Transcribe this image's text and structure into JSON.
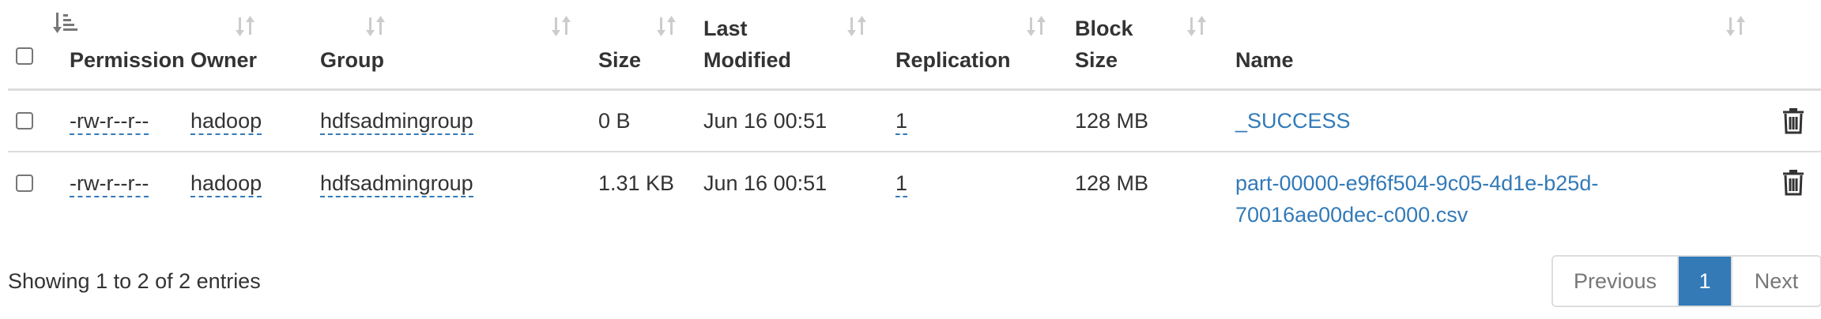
{
  "table": {
    "columns": [
      {
        "key": "select",
        "label": ""
      },
      {
        "key": "permission",
        "label": "Permission"
      },
      {
        "key": "owner",
        "label": "Owner"
      },
      {
        "key": "group",
        "label": "Group"
      },
      {
        "key": "size",
        "label": "Size"
      },
      {
        "key": "last_modified",
        "label_line1": "Last",
        "label_line2": "Modified"
      },
      {
        "key": "replication",
        "label": "Replication"
      },
      {
        "key": "block_size",
        "label_line1": "Block",
        "label_line2": "Size"
      },
      {
        "key": "name",
        "label": "Name"
      }
    ],
    "sort_state": "ascending on first column",
    "rows": [
      {
        "permission": "-rw-r--r--",
        "owner": "hadoop",
        "group": "hdfsadmingroup",
        "size": "0 B",
        "last_modified": "Jun 16 00:51",
        "replication": "1",
        "block_size": "128 MB",
        "name_line1": "_SUCCESS",
        "name_line2": ""
      },
      {
        "permission": "-rw-r--r--",
        "owner": "hadoop",
        "group": "hdfsadmingroup",
        "size": "1.31 KB",
        "last_modified": "Jun 16 00:51",
        "replication": "1",
        "block_size": "128 MB",
        "name_line1": "part-00000-e9f6f504-9c05-4d1e-b25d-",
        "name_line2": "70016ae00dec-c000.csv"
      }
    ]
  },
  "footer": {
    "info": "Showing 1 to 2 of 2 entries",
    "pagination": {
      "previous": "Previous",
      "current": "1",
      "next": "Next"
    }
  },
  "colors": {
    "link": "#337ab7",
    "active_page": "#337ab7",
    "border": "#dddddd",
    "text": "#333333"
  },
  "icons": {
    "sort_active": "sort-amount-asc-icon",
    "sort_inactive": "sort-both-icon",
    "delete": "trash-icon"
  }
}
